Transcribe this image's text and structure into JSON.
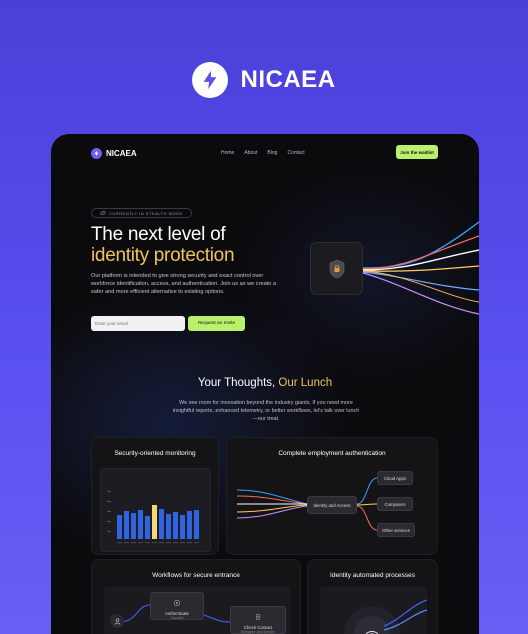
{
  "brand": {
    "name": "NICAEA"
  },
  "nav": {
    "logo_text": "NICAEA",
    "links": [
      "Home",
      "About",
      "Blog",
      "Contact"
    ],
    "cta": "Join the waitlist"
  },
  "hero": {
    "badge": "CURRENTLY IN STEALTH MODE",
    "title_line1": "The next level of",
    "title_line2": "identity protection",
    "description": "Our platform is intended to give strong security and exact control over workforce identification, access, and authentication. Join us as we create a safer and more efficient alternative to existing options.",
    "email_placeholder": "Enter your email",
    "invite_button": "Request an Invite"
  },
  "section": {
    "title_main": "Your Thoughts, ",
    "title_accent": "Our Lunch",
    "description": "We see room for innovation beyond the industry giants. If you need more insightful reports, enhanced telemetry, or better workflows, let's talk over lunch—our treat."
  },
  "cards": {
    "monitoring": {
      "title": "Security-oriented monitoring"
    },
    "employment": {
      "title": "Complete employment authentication",
      "center_box": "Identity and Access",
      "targets": [
        "Cloud Apps",
        "Computers",
        "Other services"
      ]
    },
    "workflows": {
      "title": "Workflows for secure entrance",
      "box1_title": "Authenticate",
      "box1_sub": "TouchID",
      "box2_title": "Check Contact",
      "box2_sub": "Behavior and Device"
    },
    "automated": {
      "title": "Identity automated processes"
    }
  },
  "colors": {
    "accent_green": "#b9f16d",
    "accent_gold": "#f0c25a",
    "brand_purple": "#5a4ff0",
    "bar_blue": "#2f63e0",
    "bar_highlight": "#f3d77a"
  }
}
